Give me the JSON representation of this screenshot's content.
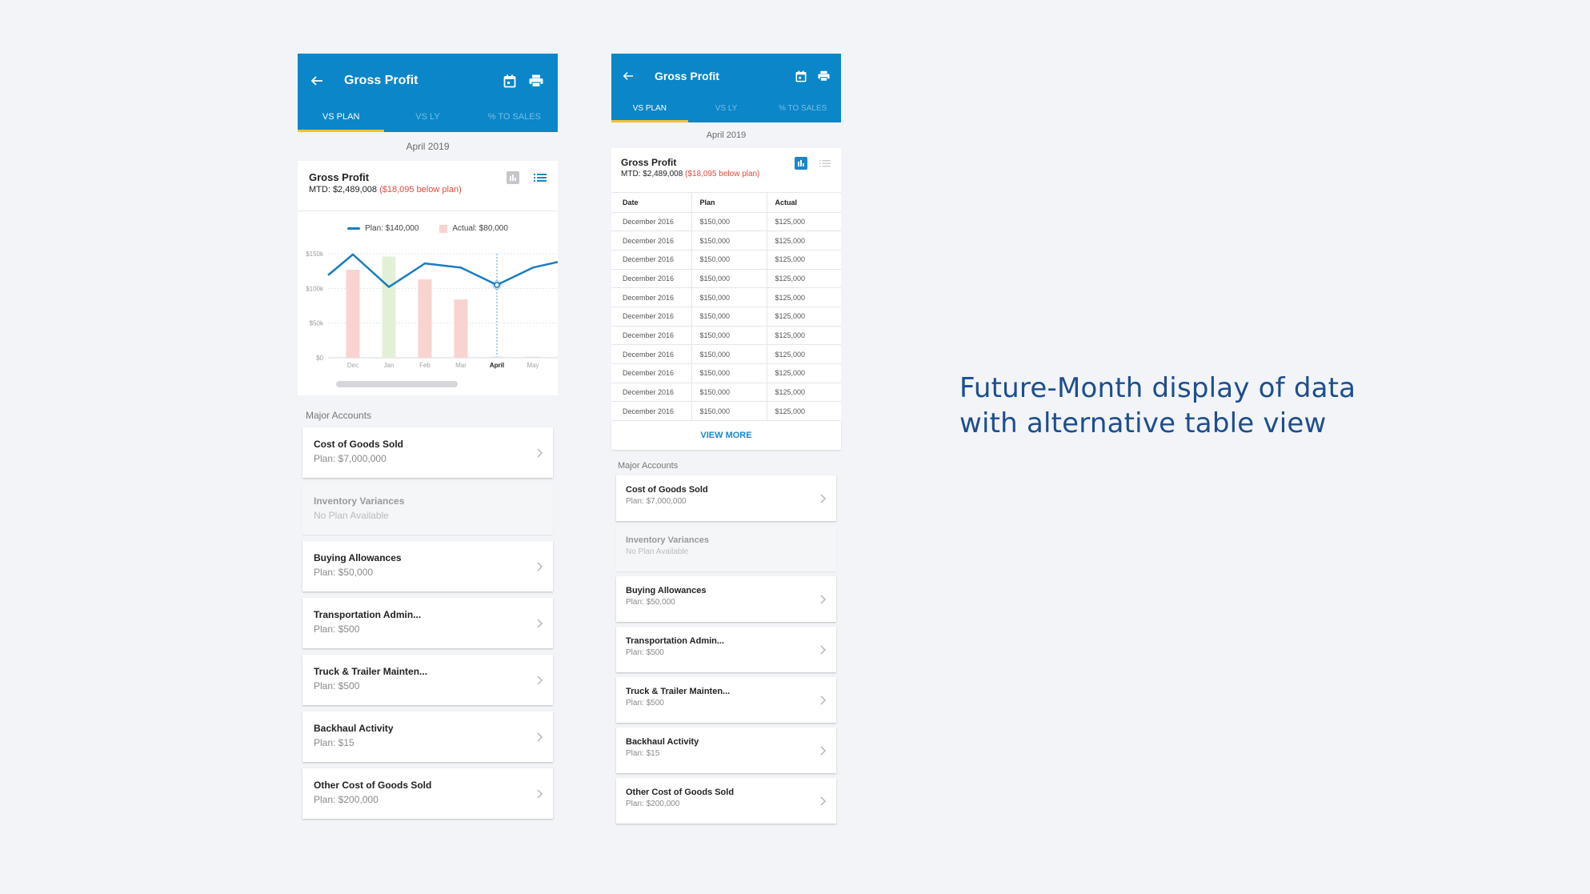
{
  "caption": {
    "line1": "Future-Month display of data",
    "line2": "with alternative table view"
  },
  "colors": {
    "app_bar": "#0a86c9",
    "tab_indicator": "#f2c12e",
    "negative": "#e04a3f",
    "plan_line": "#1a7dbf",
    "actual_below_plan": "#f8d3d0",
    "actual_above_plan": "#e3f0d8",
    "caption_text": "#1d4e8f"
  },
  "screens": {
    "left": {
      "title": "Gross Profit",
      "tabs": [
        "VS PLAN",
        "VS LY",
        "% TO SALES"
      ],
      "active_tab": "VS PLAN",
      "date": "April 2019",
      "summary": {
        "title": "Gross Profit",
        "mtd": "MTD: $2,489,008",
        "variance": "($18,095 below plan)"
      },
      "view_mode": "chart",
      "legend": {
        "plan": "Plan: $140,000",
        "actual": "Actual: $80,000"
      },
      "section_label": "Major Accounts"
    },
    "right": {
      "title": "Gross Profit",
      "tabs": [
        "VS PLAN",
        "VS LY",
        "% TO SALES"
      ],
      "active_tab": "VS PLAN",
      "date": "April 2019",
      "summary": {
        "title": "Gross Profit",
        "mtd": "MTD: $2,489,008",
        "variance": "($18,095 below plan)"
      },
      "view_mode": "table",
      "table": {
        "headers": [
          "Date",
          "Plan",
          "Actual"
        ],
        "rows": [
          [
            "December 2016",
            "$150,000",
            "$125,000"
          ],
          [
            "December 2016",
            "$150,000",
            "$125,000"
          ],
          [
            "December 2016",
            "$150,000",
            "$125,000"
          ],
          [
            "December 2016",
            "$150,000",
            "$125,000"
          ],
          [
            "December 2016",
            "$150,000",
            "$125,000"
          ],
          [
            "December 2016",
            "$150,000",
            "$125,000"
          ],
          [
            "December 2016",
            "$150,000",
            "$125,000"
          ],
          [
            "December 2016",
            "$150,000",
            "$125,000"
          ],
          [
            "December 2016",
            "$150,000",
            "$125,000"
          ],
          [
            "December 2016",
            "$150,000",
            "$125,000"
          ],
          [
            "December 2016",
            "$150,000",
            "$125,000"
          ]
        ]
      },
      "view_more": "VIEW MORE",
      "section_label": "Major Accounts"
    }
  },
  "accounts": [
    {
      "name": "Cost of Goods Sold",
      "plan": "Plan: $7,000,000",
      "disabled": false
    },
    {
      "name": "Inventory Variances",
      "plan": "No Plan Available",
      "disabled": true
    },
    {
      "name": "Buying Allowances",
      "plan": "Plan: $50,000",
      "disabled": false
    },
    {
      "name": "Transportation Admin...",
      "plan": "Plan: $500",
      "disabled": false
    },
    {
      "name": "Truck & Trailer Mainten...",
      "plan": "Plan: $500",
      "disabled": false
    },
    {
      "name": "Backhaul Activity",
      "plan": "Plan: $15",
      "disabled": false
    },
    {
      "name": "Other Cost of Goods Sold",
      "plan": "Plan: $200,000",
      "disabled": false
    }
  ],
  "chart_data": {
    "type": "bar",
    "title": "",
    "xlabel": "",
    "ylabel": "",
    "categories": [
      "Dec",
      "Jan",
      "Feb",
      "Mar",
      "April",
      "May"
    ],
    "selected_category": "April",
    "yticks": [
      "$0",
      "$50k",
      "$100k",
      "$150k"
    ],
    "ylim": [
      0,
      150000
    ],
    "grid": true,
    "legend_position": "top",
    "series": [
      {
        "name": "Actual",
        "type": "bar",
        "values": [
          127000,
          146000,
          113000,
          84000,
          0,
          0
        ],
        "above_plan": [
          false,
          true,
          false,
          false,
          false,
          false
        ]
      },
      {
        "name": "Plan",
        "type": "line",
        "values": [
          149000,
          102000,
          136000,
          130000,
          105000,
          130000
        ],
        "lead_in": 119000,
        "lead_out": 138000
      }
    ]
  }
}
